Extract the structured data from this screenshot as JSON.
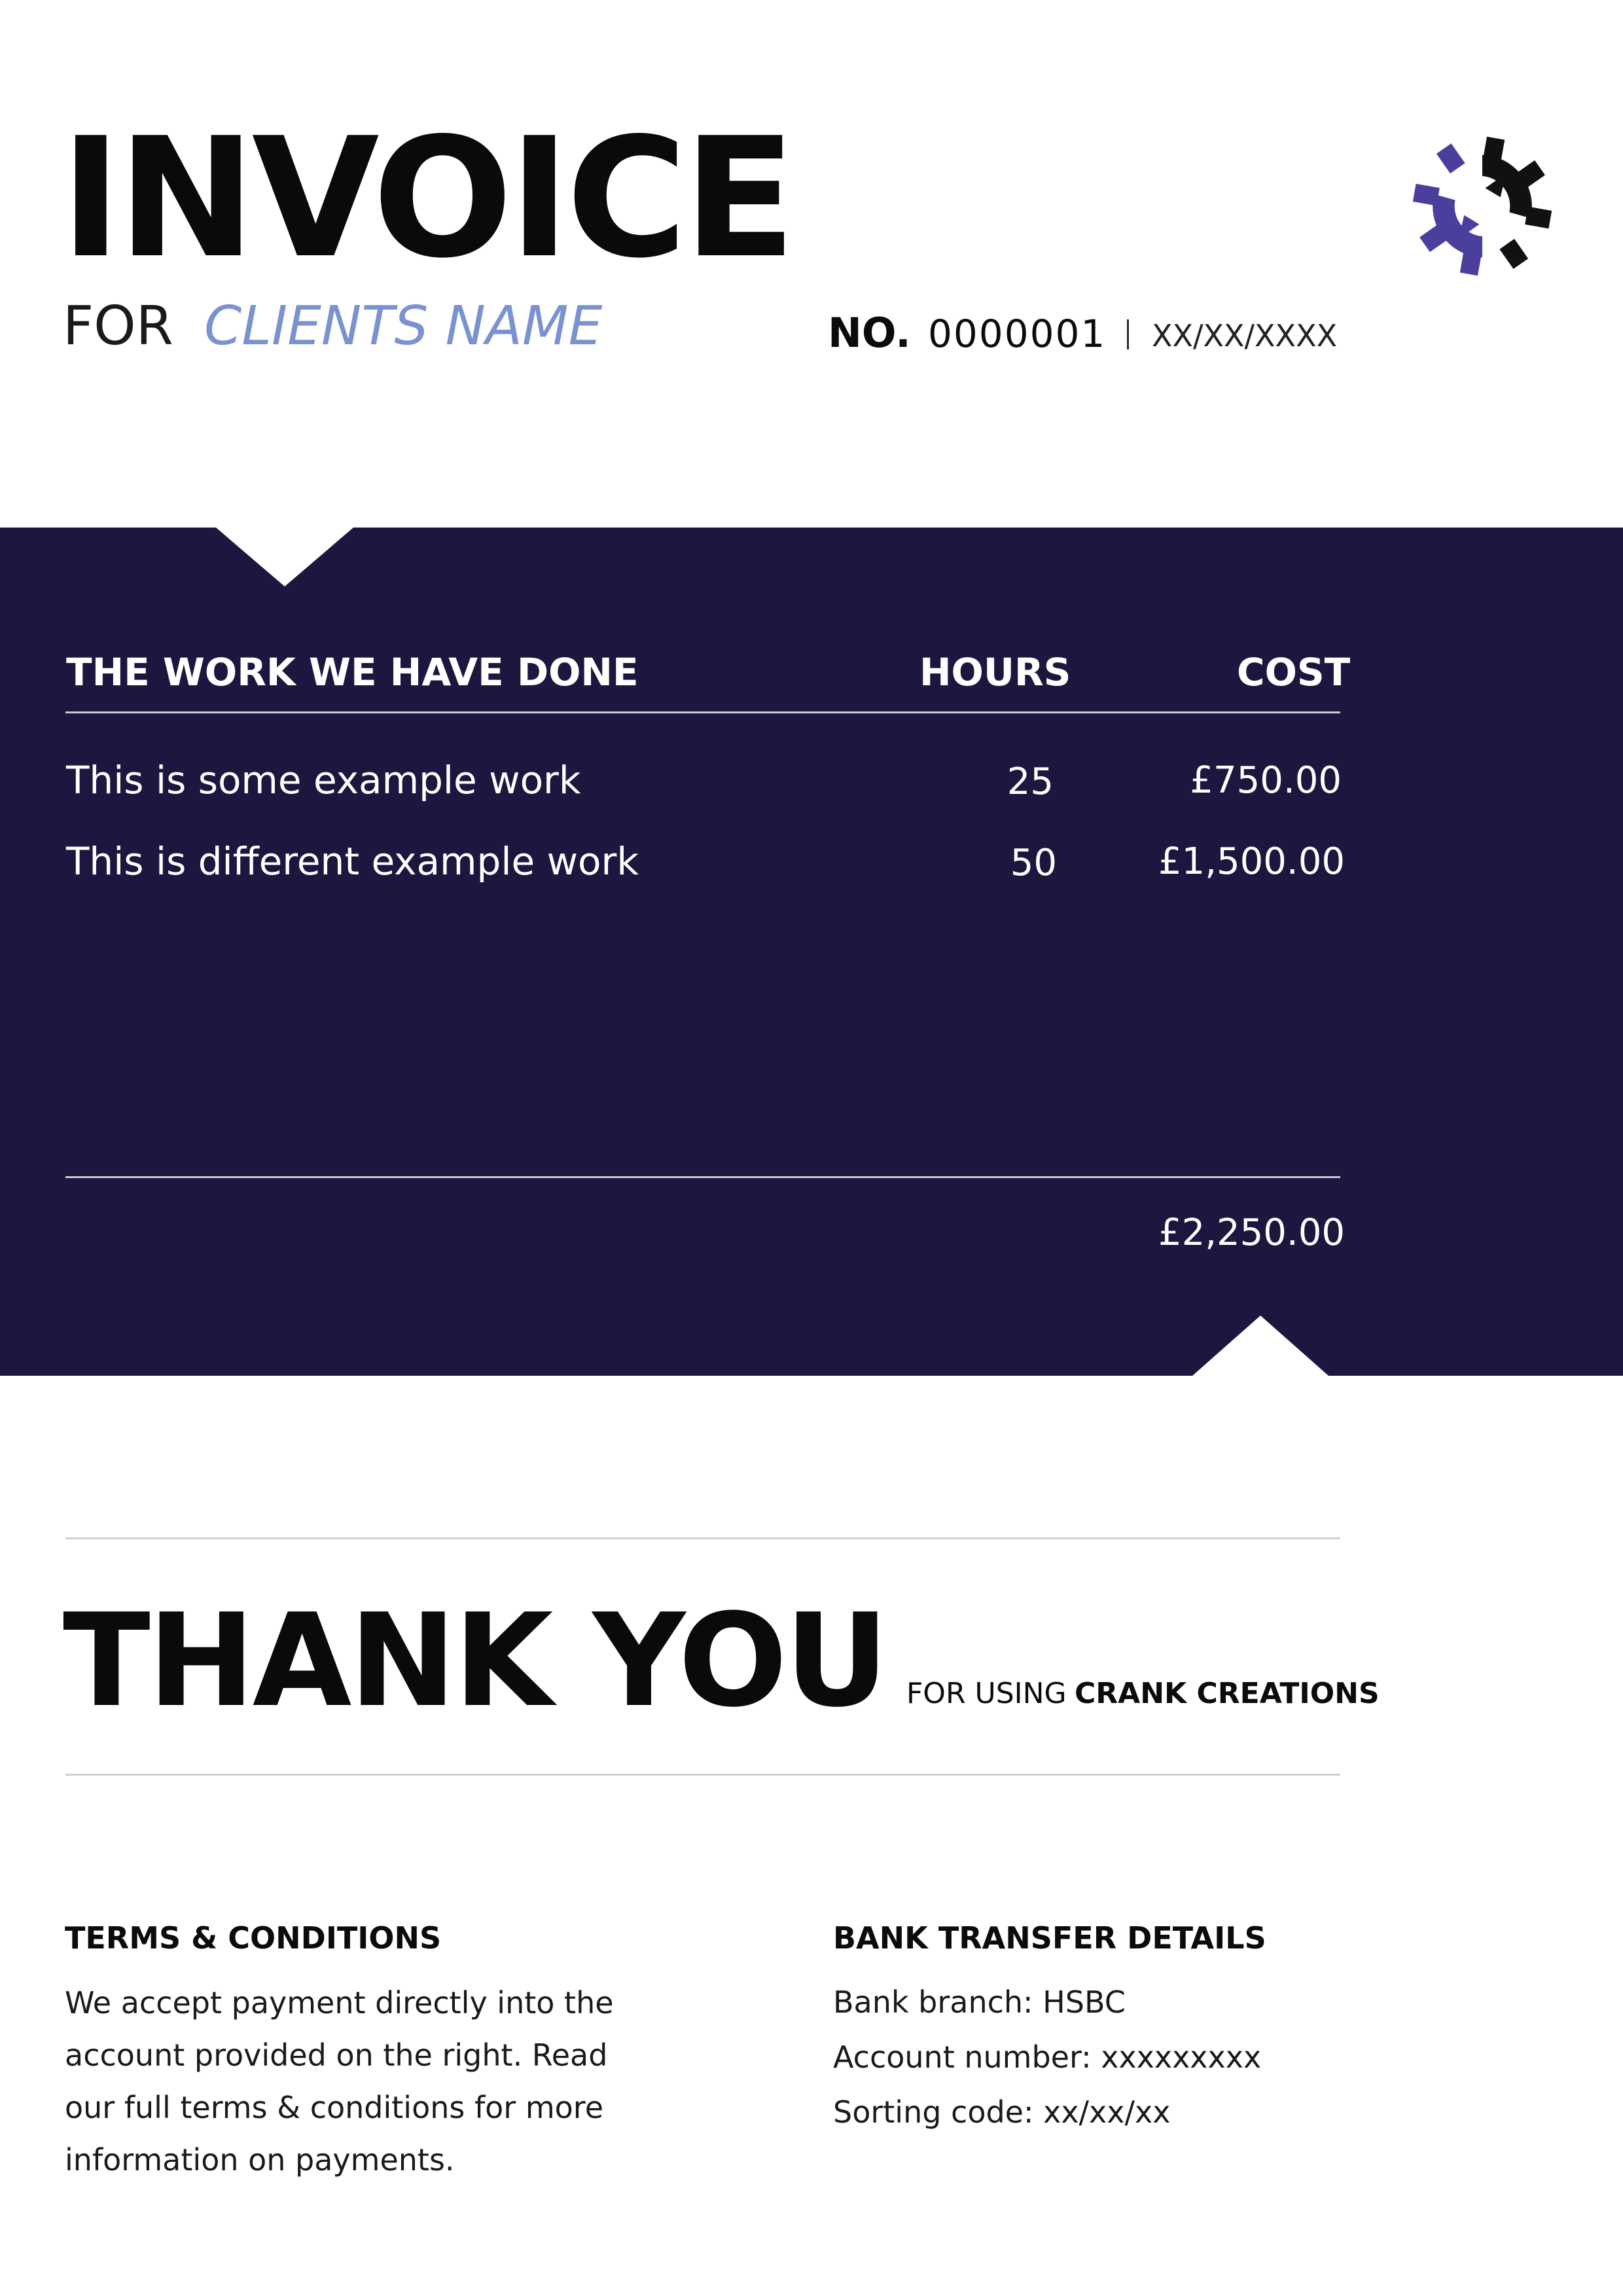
{
  "header": {
    "title": "INVOICE",
    "for_label": "FOR",
    "client_name": "CLIENTS NAME",
    "number_label": "NO.",
    "invoice_number": "0000001",
    "date": "XX/XX/XXXX",
    "logo_icon": "gear-refresh-icon"
  },
  "work_table": {
    "headers": {
      "work": "THE WORK WE HAVE DONE",
      "hours": "HOURS",
      "cost": "COST"
    },
    "rows": [
      {
        "description": "This is some example work",
        "hours": "25",
        "cost": "£750.00"
      },
      {
        "description": "This is different example work",
        "hours": "50",
        "cost": "£1,500.00"
      }
    ],
    "total": "£2,250.00"
  },
  "thanks": {
    "headline": "THANK YOU",
    "for_using": "FOR USING",
    "company": "CRANK CREATIONS"
  },
  "terms": {
    "heading": "TERMS & CONDITIONS",
    "body": "We accept payment directly into the account provided on the right. Read our full terms & conditions for more information on payments."
  },
  "bank": {
    "heading": "BANK TRANSFER DETAILS",
    "branch": "Bank branch: HSBC",
    "account": "Account number: xxxxxxxxx",
    "sorting": "Sorting code: xx/xx/xx"
  },
  "colors": {
    "band": "#1d1740",
    "accent": "#7a92cf",
    "logo_primary": "#4b3f9e",
    "logo_secondary": "#111111"
  }
}
